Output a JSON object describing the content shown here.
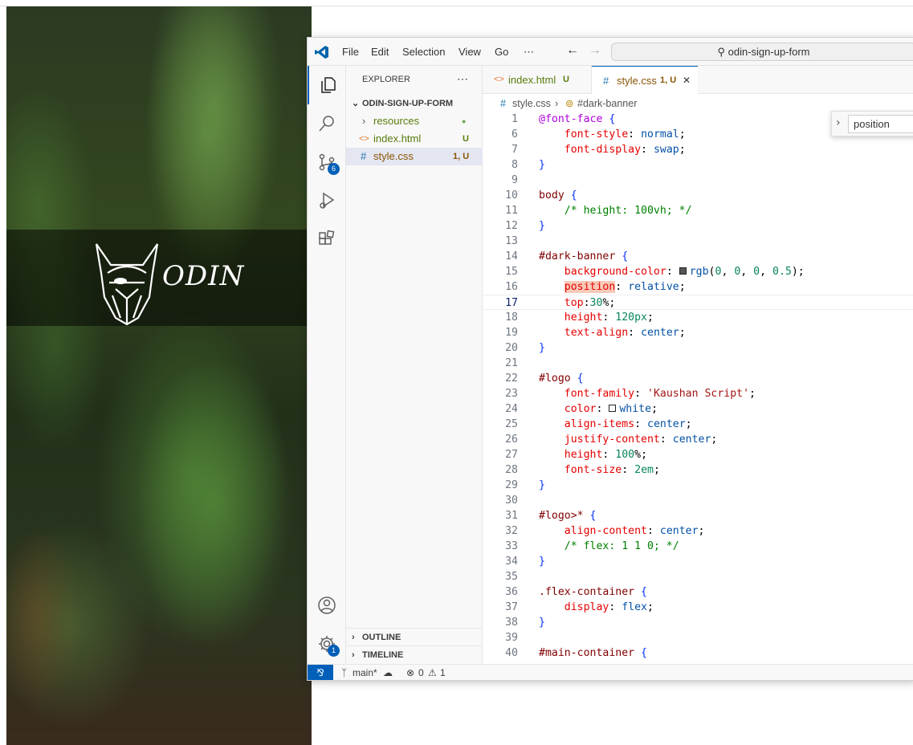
{
  "app": {
    "search_title": "odin-sign-up-form"
  },
  "menu": [
    "File",
    "Edit",
    "Selection",
    "View",
    "Go",
    "⋯"
  ],
  "activity": {
    "scm_badge": "6",
    "settings_badge": "1"
  },
  "banner": {
    "logo_text": "ODIN"
  },
  "explorer": {
    "title": "EXPLORER",
    "more": "⋯",
    "root": "ODIN-SIGN-UP-FORM",
    "items": [
      {
        "name": "resources",
        "status": "●",
        "color": "#587c0c"
      },
      {
        "name": "index.html",
        "status": "U",
        "color": "#587c0c"
      },
      {
        "name": "style.css",
        "status": "1, U",
        "color": "#895503"
      }
    ],
    "outline": "OUTLINE",
    "timeline": "TIMELINE"
  },
  "tabs": [
    {
      "icon": "<>",
      "label": "index.html",
      "status": "U"
    },
    {
      "icon": "#",
      "label": "style.css",
      "status": "1, U",
      "close": "✕"
    }
  ],
  "breadcrumb": {
    "file": "style.css",
    "symbol": "#dark-banner"
  },
  "find": {
    "value": "position"
  },
  "code": [
    {
      "n": "1",
      "t": "@font-face {"
    },
    {
      "n": "6",
      "t": "    font-style: normal;"
    },
    {
      "n": "7",
      "t": "    font-display: swap;"
    },
    {
      "n": "8",
      "t": "}"
    },
    {
      "n": "9",
      "t": ""
    },
    {
      "n": "10",
      "t": "body {"
    },
    {
      "n": "11",
      "t": "    /* height: 100vh; */"
    },
    {
      "n": "12",
      "t": "}"
    },
    {
      "n": "13",
      "t": ""
    },
    {
      "n": "14",
      "t": "#dark-banner {"
    },
    {
      "n": "15",
      "t": "    background-color: ■rgb(0, 0, 0, 0.5);"
    },
    {
      "n": "16",
      "t": "    position: relative;"
    },
    {
      "n": "17",
      "t": "    top:30%;"
    },
    {
      "n": "18",
      "t": "    height: 120px;"
    },
    {
      "n": "19",
      "t": "    text-align: center;"
    },
    {
      "n": "20",
      "t": "}"
    },
    {
      "n": "21",
      "t": ""
    },
    {
      "n": "22",
      "t": "#logo {"
    },
    {
      "n": "23",
      "t": "    font-family: 'Kaushan Script';"
    },
    {
      "n": "24",
      "t": "    color: □white;"
    },
    {
      "n": "25",
      "t": "    align-items: center;"
    },
    {
      "n": "26",
      "t": "    justify-content: center;"
    },
    {
      "n": "27",
      "t": "    height: 100%;"
    },
    {
      "n": "28",
      "t": "    font-size: 2em;"
    },
    {
      "n": "29",
      "t": "}"
    },
    {
      "n": "30",
      "t": ""
    },
    {
      "n": "31",
      "t": "#logo>* {"
    },
    {
      "n": "32",
      "t": "    align-content: center;"
    },
    {
      "n": "33",
      "t": "    /* flex: 1 1 0; */"
    },
    {
      "n": "34",
      "t": "}"
    },
    {
      "n": "35",
      "t": ""
    },
    {
      "n": "36",
      "t": ".flex-container {"
    },
    {
      "n": "37",
      "t": "    display: flex;"
    },
    {
      "n": "38",
      "t": "}"
    },
    {
      "n": "39",
      "t": ""
    },
    {
      "n": "40",
      "t": "#main-container {"
    }
  ],
  "status": {
    "branch": "main*",
    "errors": "0",
    "warnings": "1"
  }
}
